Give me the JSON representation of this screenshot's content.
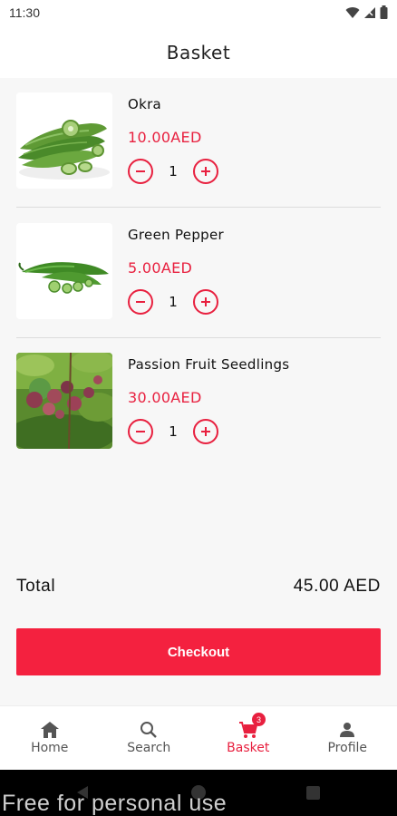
{
  "status_bar": {
    "time": "11:30"
  },
  "header": {
    "title": "Basket"
  },
  "items": [
    {
      "name": "Okra",
      "price": "10.00AED",
      "quantity": "1"
    },
    {
      "name": "Green Pepper",
      "price": "5.00AED",
      "quantity": "1"
    },
    {
      "name": "Passion Fruit Seedlings",
      "price": "30.00AED",
      "quantity": "1"
    }
  ],
  "summary": {
    "total_label": "Total",
    "total_value": "45.00 AED"
  },
  "checkout_label": "Checkout",
  "bottom_nav": {
    "items": [
      {
        "label": "Home",
        "icon": "home-icon"
      },
      {
        "label": "Search",
        "icon": "search-icon"
      },
      {
        "label": "Basket",
        "icon": "cart-icon",
        "badge": "3",
        "active": true
      },
      {
        "label": "Profile",
        "icon": "person-icon"
      }
    ]
  },
  "watermark": "Free for personal use",
  "colors": {
    "accent": "#e8203f",
    "checkout_bg": "#f4213f",
    "content_bg": "#f7f7f7"
  }
}
